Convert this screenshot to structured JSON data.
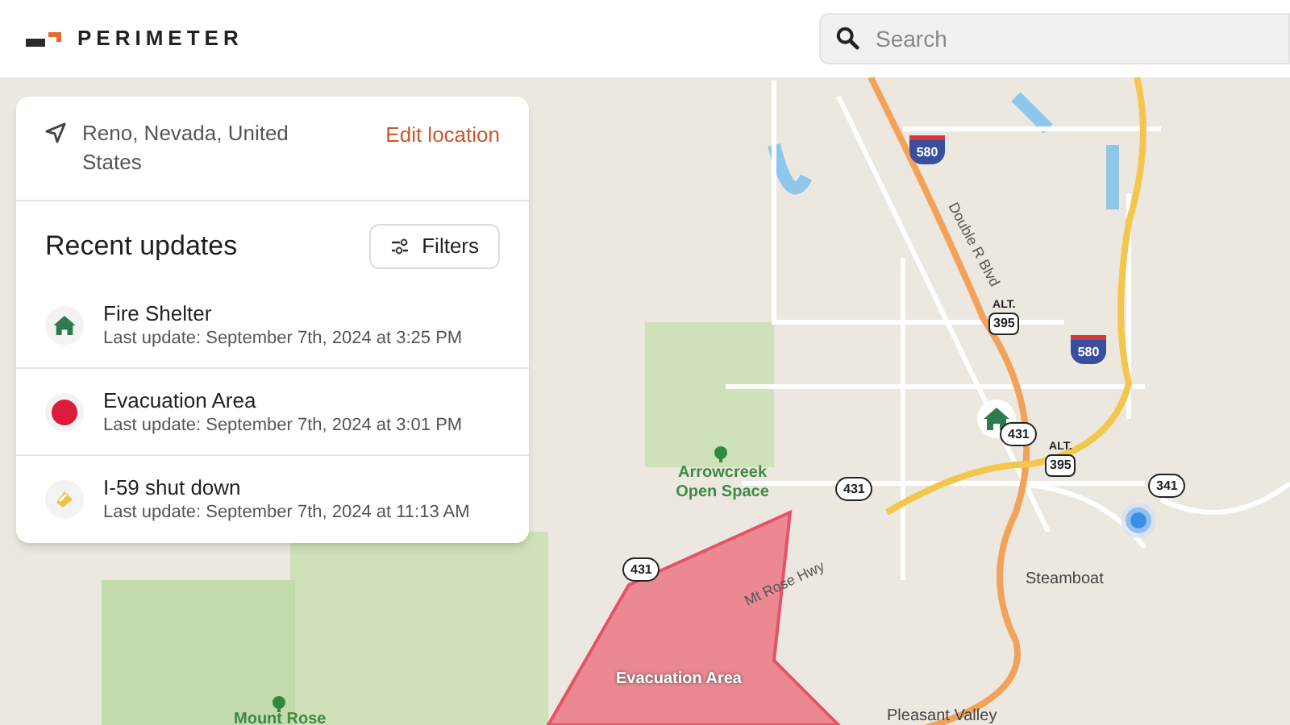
{
  "header": {
    "brand": "PERIMETER",
    "search": {
      "placeholder": "Search"
    }
  },
  "location": {
    "text": "Reno, Nevada, United States",
    "action": "Edit location"
  },
  "updates": {
    "title": "Recent updates",
    "filter_button": "Filters",
    "items": [
      {
        "kind": "shelter",
        "title": "Fire Shelter",
        "subtitle": "Last update: September 7th, 2024 at 3:25 PM"
      },
      {
        "kind": "evacuation",
        "title": "Evacuation Area",
        "subtitle": "Last update: September 7th, 2024 at 3:01 PM"
      },
      {
        "kind": "closure",
        "title": "I-59 shut down",
        "subtitle": "Last update: September 7th, 2024 at 11:13 AM"
      }
    ]
  },
  "map": {
    "labels": [
      {
        "kind": "street",
        "text": "Double R Blvd"
      },
      {
        "kind": "park",
        "text": "Arrowcreek Open Space"
      },
      {
        "kind": "street",
        "text": "Mt Rose Hwy"
      },
      {
        "kind": "place",
        "text": "Steamboat"
      },
      {
        "kind": "zone",
        "text": "Evacuation Area"
      },
      {
        "kind": "park",
        "text": "Mount Rose"
      },
      {
        "kind": "place",
        "text": "Pleasant Valley"
      }
    ],
    "shields": [
      {
        "kind": "interstate",
        "number": "580"
      },
      {
        "kind": "interstate",
        "number": "580"
      },
      {
        "kind": "us",
        "prefix": "ALT.",
        "number": "395"
      },
      {
        "kind": "us",
        "prefix": "ALT.",
        "number": "395"
      },
      {
        "kind": "state",
        "number": "431"
      },
      {
        "kind": "state",
        "number": "431"
      },
      {
        "kind": "state",
        "number": "431"
      },
      {
        "kind": "state",
        "number": "341"
      }
    ]
  }
}
